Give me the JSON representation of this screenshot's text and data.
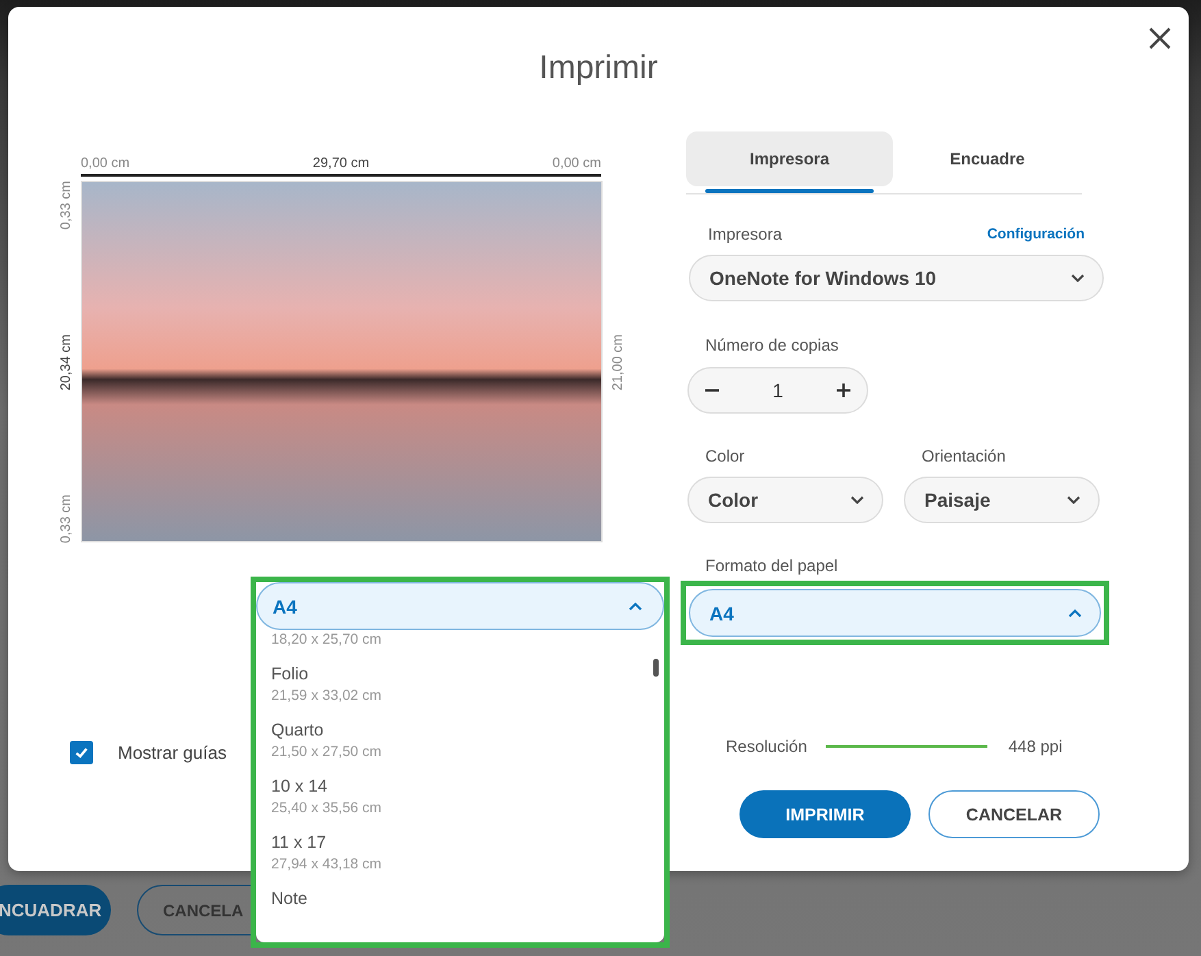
{
  "background": {
    "buttons": [
      {
        "label": "NCUADRAR",
        "kind": "primary"
      },
      {
        "label": "CANCELA",
        "kind": "outline"
      }
    ]
  },
  "dialog": {
    "title": "Imprimir"
  },
  "preview": {
    "top_ruler": [
      "0,00 cm",
      "29,70 cm",
      "0,00 cm"
    ],
    "left_ruler": [
      "0,33 cm",
      "20,34 cm",
      "0,33 cm"
    ],
    "right_ruler": "21,00 cm"
  },
  "show_guides": {
    "label": "Mostrar guías",
    "checked": true
  },
  "tabs": [
    {
      "label": "Impresora",
      "selected": true
    },
    {
      "label": "Encuadre",
      "selected": false
    }
  ],
  "printer": {
    "label": "Impresora",
    "link": "Configuración",
    "value": "OneNote for Windows 10"
  },
  "copies": {
    "label": "Número de copias",
    "value": "1"
  },
  "color": {
    "label": "Color",
    "value": "Color"
  },
  "orientation": {
    "label": "Orientación",
    "value": "Paisaje"
  },
  "paper": {
    "label": "Formato del papel",
    "value": "A4",
    "expanded": true,
    "highlighted": true
  },
  "resolution": {
    "label": "Resolución",
    "reading": "448 ppi"
  },
  "buttons": [
    {
      "label": "IMPRIMIR",
      "kind": "primary"
    },
    {
      "label": "CANCELAR",
      "kind": "outline"
    }
  ],
  "paper_dropdown": {
    "value": "A4",
    "expanded": true,
    "highlighted": true,
    "options": [
      {
        "size": "18,20 x 25,70 cm"
      },
      {
        "name": "Folio",
        "size": "21,59 x 33,02 cm"
      },
      {
        "name": "Quarto",
        "size": "21,50 x 27,50 cm"
      },
      {
        "name": "10 x 14",
        "size": "25,40 x 35,56 cm"
      },
      {
        "name": "11 x 17",
        "size": "27,94 x 43,18 cm"
      },
      {
        "name": "Note"
      }
    ]
  }
}
